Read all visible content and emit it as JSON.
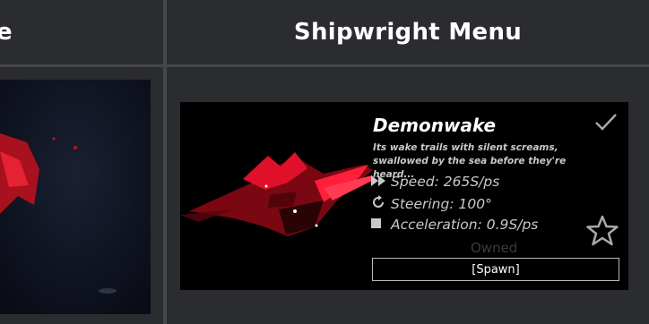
{
  "left_header": {
    "title_fragment": "e"
  },
  "right_header": {
    "title": "Shipwright Menu"
  },
  "ship": {
    "name": "Demonwake",
    "description": "Its wake trails with silent screams, swallowed by the sea before they're heard...",
    "stats": {
      "speed": "Speed: 265S/ps",
      "steering": "Steering: 100°",
      "acceleration": "Acceleration: 0.9S/ps"
    },
    "status": "Owned",
    "spawn_label": "[Spawn]"
  },
  "icons": {
    "speed": "fast-forward-icon",
    "steering": "rotate-icon",
    "acceleration": "square-icon",
    "selected": "checkmark-icon",
    "favorite": "star-icon"
  },
  "colors": {
    "background": "#2b2c30",
    "divider": "#46474d",
    "card": "#000000",
    "ship_accent": "#e0102a"
  }
}
